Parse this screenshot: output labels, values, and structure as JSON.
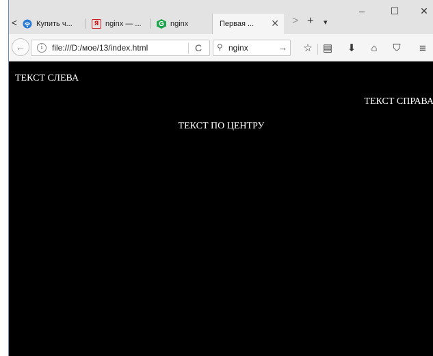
{
  "tabs": [
    {
      "label": "Купить ч...",
      "icon": "wifi-icon"
    },
    {
      "label": "nginx — ...",
      "icon": "yandex-icon",
      "icon_text": "Я"
    },
    {
      "label": "nginx",
      "icon": "nginx-icon",
      "icon_text": "G"
    },
    {
      "label": "Первая ...",
      "active": true
    }
  ],
  "tabbar": {
    "scroll_left": "<",
    "scroll_right": ">",
    "new_tab": "+",
    "list_tabs": "▾",
    "close_tab": "✕"
  },
  "window_controls": {
    "minimize": "–",
    "maximize": "☐",
    "close": "✕"
  },
  "navbar": {
    "back": "←",
    "info": "i",
    "url": "file:///D:/мое/13/index.html",
    "reload": "C",
    "search_value": "nginx",
    "search_go": "→",
    "bookmark": "☆",
    "reader": "▤",
    "download": "⬇",
    "home": "⌂",
    "pocket": "⛉",
    "menu": "≡"
  },
  "content": {
    "left_text": "ТЕКСТ СЛЕВА",
    "right_text": "ТЕКСТ СПРАВА",
    "center_text": "ТЕКСТ ПО ЦЕНТРУ"
  },
  "colors": {
    "page_background": "#000000",
    "text": "#ffffff",
    "chrome": "#e3e3e3"
  }
}
